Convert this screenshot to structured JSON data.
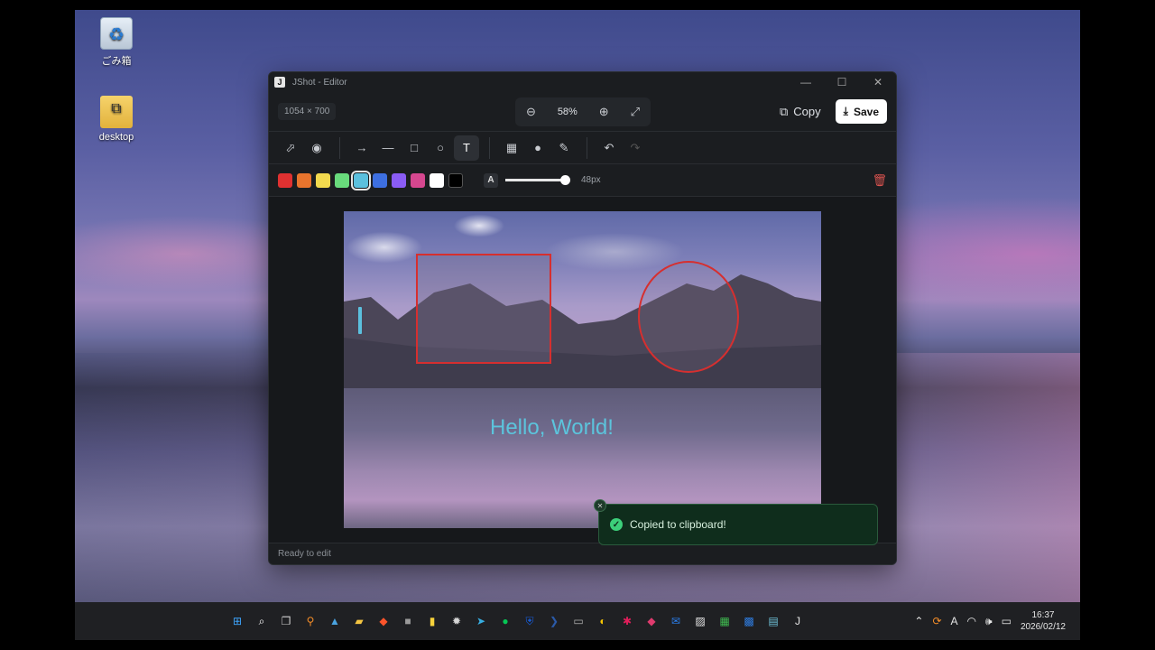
{
  "desktop": {
    "icons": [
      {
        "label": "ごみ箱",
        "icon": "recycle-bin-icon"
      },
      {
        "label": "desktop",
        "icon": "folder-icon"
      }
    ]
  },
  "window": {
    "title": "JShot - Editor",
    "app_logo": "J",
    "controls": {
      "minimize": "—",
      "maximize": "☐",
      "close": "✕"
    }
  },
  "header": {
    "dimensions": "1054 × 700",
    "zoom": {
      "out_icon": "⊖",
      "value": "58%",
      "in_icon": "⊕",
      "fit_icon": "⤢"
    },
    "copy_label": "Copy",
    "save_label": "Save"
  },
  "tools": {
    "select": "⬀",
    "palette": "◉",
    "arrow": "→",
    "line": "—",
    "rect": "□",
    "ellipse": "○",
    "text": "T",
    "mosaic": "▦",
    "blur": "●",
    "highlighter": "✎",
    "undo": "↶",
    "redo": "↷",
    "active": "text"
  },
  "colors": {
    "swatches": [
      "#e03131",
      "#e8742d",
      "#f2d94e",
      "#69db7c",
      "#5bc0de",
      "#3d6fe0",
      "#8a5cf5",
      "#d6478f",
      "#ffffff",
      "#000000"
    ],
    "selected_index": 4
  },
  "size": {
    "icon_label": "A",
    "value_label": "48px",
    "fraction": 1.0
  },
  "canvas": {
    "text_annotation": "Hello, World!",
    "annotation_color": "#d62f2f",
    "text_color": "#5cc4dc"
  },
  "status": {
    "text": "Ready to edit"
  },
  "toast": {
    "message": "Copied to clipboard!",
    "check": "✓",
    "close": "✕"
  },
  "taskbar": {
    "apps": [
      {
        "name": "start-icon",
        "glyph": "⊞",
        "color": "#3ea6ff"
      },
      {
        "name": "search-icon",
        "glyph": "⌕",
        "color": "#ffffff"
      },
      {
        "name": "task-view-icon",
        "glyph": "❐",
        "color": "#cfcfcf"
      },
      {
        "name": "search-app-icon",
        "glyph": "⚲",
        "color": "#f28c28"
      },
      {
        "name": "photos-icon",
        "glyph": "▲",
        "color": "#4aa3df"
      },
      {
        "name": "file-explorer-icon",
        "glyph": "▰",
        "color": "#f4c542"
      },
      {
        "name": "brave-icon",
        "glyph": "◆",
        "color": "#fb542b"
      },
      {
        "name": "terminal-icon",
        "glyph": "■",
        "color": "#9a9a9a"
      },
      {
        "name": "sticky-notes-icon",
        "glyph": "▮",
        "color": "#f7d23b"
      },
      {
        "name": "settings-icon",
        "glyph": "✹",
        "color": "#d6d6d6"
      },
      {
        "name": "telegram-icon",
        "glyph": "➤",
        "color": "#37aee2"
      },
      {
        "name": "line-icon",
        "glyph": "●",
        "color": "#06c755"
      },
      {
        "name": "bitwarden-icon",
        "glyph": "⛨",
        "color": "#175ddc"
      },
      {
        "name": "powershell-icon",
        "glyph": "❯",
        "color": "#2b5aa8"
      },
      {
        "name": "console-icon",
        "glyph": "▭",
        "color": "#b0b0b0"
      },
      {
        "name": "bing-icon",
        "glyph": "◐",
        "color": "#f7c600"
      },
      {
        "name": "slack-icon",
        "glyph": "✱",
        "color": "#e01e5a"
      },
      {
        "name": "brave-beta-icon",
        "glyph": "◆",
        "color": "#e03b6e"
      },
      {
        "name": "mail-icon",
        "glyph": "✉",
        "color": "#2b7de9"
      },
      {
        "name": "notion-icon",
        "glyph": "▨",
        "color": "#e6e6e6"
      },
      {
        "name": "calendar-icon",
        "glyph": "▦",
        "color": "#3fb950"
      },
      {
        "name": "office-icon",
        "glyph": "▩",
        "color": "#2f7de1"
      },
      {
        "name": "notepad-icon",
        "glyph": "▤",
        "color": "#6fc2d9"
      },
      {
        "name": "jshot-icon",
        "glyph": "J",
        "color": "#e6e6e6"
      }
    ],
    "tray": {
      "chevron": "⌃",
      "sync": "⟳",
      "ime": "A",
      "wifi": "◠",
      "volume": "🕪",
      "battery": "▭"
    },
    "clock": {
      "time": "16:37",
      "date": "2026/02/12"
    }
  }
}
